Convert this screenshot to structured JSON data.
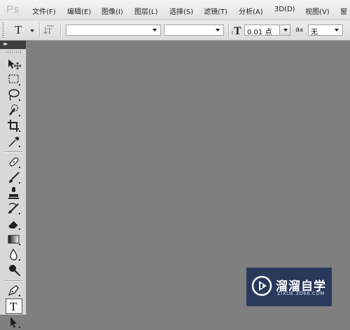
{
  "app": {
    "logo_text": "Ps"
  },
  "menubar": {
    "items": [
      {
        "label": "文件(F)"
      },
      {
        "label": "编辑(E)"
      },
      {
        "label": "图像(I)"
      },
      {
        "label": "图层(L)"
      },
      {
        "label": "选择(S)"
      },
      {
        "label": "滤镜(T)"
      },
      {
        "label": "分析(A)"
      },
      {
        "label": "3D(D)"
      },
      {
        "label": "视图(V)"
      },
      {
        "label": "窗"
      }
    ]
  },
  "options_bar": {
    "tool_preset_glyph": "T",
    "orientation_icon": "text-orientation-icon",
    "font_family": {
      "value": ""
    },
    "font_style": {
      "value": ""
    },
    "font_size": {
      "value": "0.01 点",
      "icon": "font-size-icon"
    },
    "antialias": {
      "icon_label": "a",
      "icon_label_small": "a",
      "value": "无"
    }
  },
  "toolbox": {
    "header_glyph": "▸▸",
    "active_tool": "type-tool",
    "tools": [
      {
        "name": "move-tool"
      },
      {
        "name": "rectangular-marquee-tool"
      },
      {
        "name": "lasso-tool"
      },
      {
        "name": "quick-selection-tool"
      },
      {
        "name": "crop-tool"
      },
      {
        "name": "eyedropper-tool"
      },
      {
        "name": "spot-healing-brush-tool"
      },
      {
        "name": "brush-tool"
      },
      {
        "name": "clone-stamp-tool"
      },
      {
        "name": "history-brush-tool"
      },
      {
        "name": "eraser-tool"
      },
      {
        "name": "gradient-tool"
      },
      {
        "name": "blur-tool"
      },
      {
        "name": "dodge-tool"
      },
      {
        "name": "pen-tool"
      },
      {
        "name": "type-tool"
      },
      {
        "name": "path-selection-tool"
      }
    ]
  },
  "watermark": {
    "title": "溜溜自学",
    "url": "ZIXUE.3D66.COM"
  },
  "colors": {
    "canvas": "#7f7f7f",
    "watermark_bg": "#1c3058"
  }
}
